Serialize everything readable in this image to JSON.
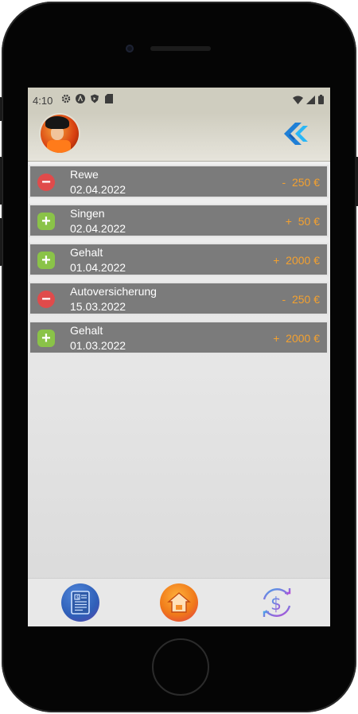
{
  "status_bar": {
    "time": "4:10",
    "icons": [
      "gear-icon",
      "a-circle-icon",
      "shield-icon",
      "sd-card-icon"
    ],
    "right_icons": [
      "wifi-icon",
      "signal-icon",
      "battery-icon"
    ]
  },
  "app_bar": {
    "avatar_icon": "profile-avatar",
    "logo_icon": "flutter-logo-icon"
  },
  "transactions": [
    {
      "type": "minus",
      "title": "Rewe",
      "date": "02.04.2022",
      "amount": "-  250 €"
    },
    {
      "type": "plus",
      "title": "Singen",
      "date": "02.04.2022",
      "amount": "+  50 €"
    },
    {
      "type": "plus",
      "title": "Gehalt",
      "date": "01.04.2022",
      "amount": "+  2000 €"
    },
    {
      "type": "minus",
      "title": "Autoversicherung",
      "date": "15.03.2022",
      "amount": "-  250 €"
    },
    {
      "type": "plus",
      "title": "Gehalt",
      "date": "01.03.2022",
      "amount": "+  2000 €"
    }
  ],
  "bottom_nav": [
    {
      "icon": "report-icon"
    },
    {
      "icon": "home-icon"
    },
    {
      "icon": "currency-exchange-icon"
    }
  ],
  "colors": {
    "row_bg": "#7b7b7b",
    "amount": "#f4a12f",
    "minus": "#e04b4b",
    "plus": "#8ac348",
    "appbar": "#cfcdbf"
  }
}
